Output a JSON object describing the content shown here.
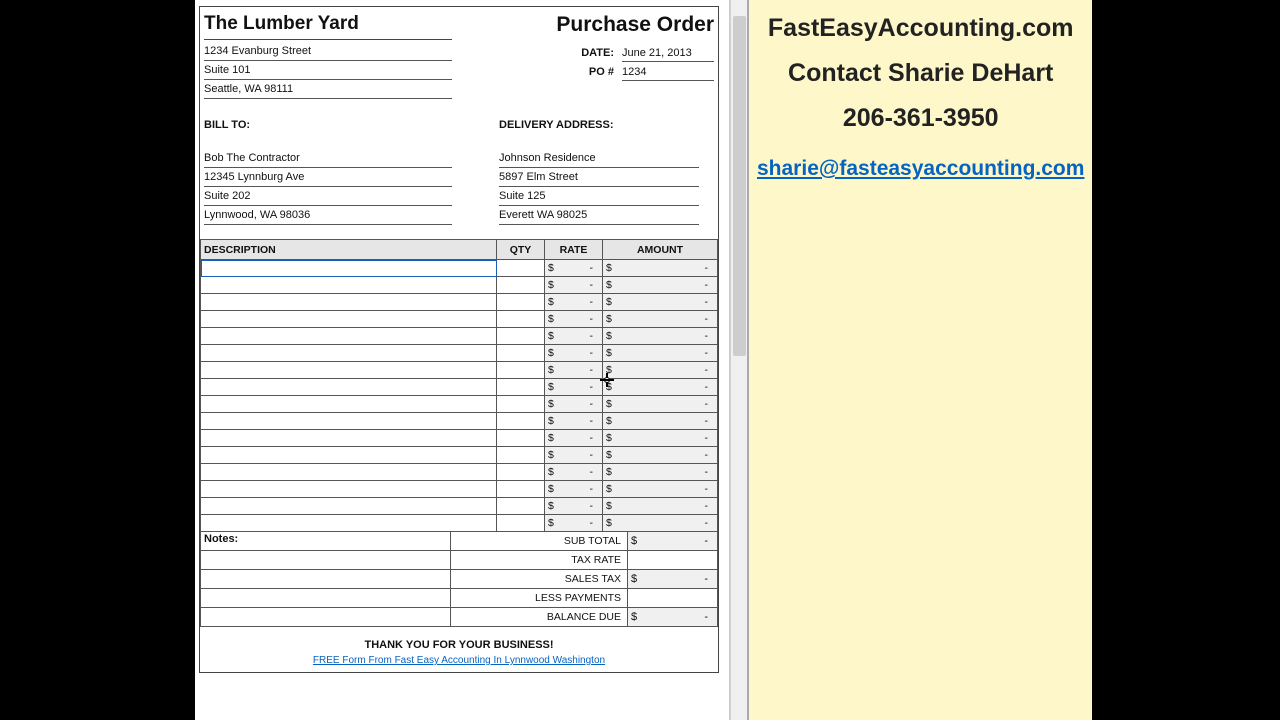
{
  "doc": {
    "title": "Purchase Order",
    "company": {
      "name": "The Lumber Yard",
      "addr1": "1234 Evanburg Street",
      "addr2": "Suite 101",
      "addr3": "Seattle, WA 98111"
    },
    "meta": {
      "date_label": "DATE:",
      "date_val": "June 21, 2013",
      "po_label": "PO #",
      "po_val": "1234"
    },
    "bill_to": {
      "head": "BILL TO:",
      "l1": "Bob The Contractor",
      "l2": "12345 Lynnburg Ave",
      "l3": "Suite 202",
      "l4": "Lynnwood, WA 98036"
    },
    "delivery": {
      "head": "DELIVERY ADDRESS:",
      "l1": "Johnson Residence",
      "l2": "5897 Elm Street",
      "l3": "Suite 125",
      "l4": "Everett WA 98025"
    },
    "headers": {
      "desc": "DESCRIPTION",
      "qty": "QTY",
      "rate": "RATE",
      "amount": "AMOUNT"
    },
    "notes_label": "Notes:",
    "totals": {
      "subtotal": "SUB TOTAL",
      "taxrate": "TAX RATE",
      "salestax": "SALES TAX",
      "lesspay": "LESS PAYMENTS",
      "balance": "BALANCE DUE"
    },
    "thanks": "THANK YOU FOR YOUR BUSINESS!",
    "freelink": "FREE Form From Fast Easy Accounting In Lynnwood Washington"
  },
  "info": {
    "l1": "FastEasyAccounting.com",
    "l2": "Contact Sharie DeHart",
    "l3": "206-361-3950",
    "email": "sharie@fasteasyaccounting.com"
  },
  "sym": {
    "dollar": "$",
    "dash": "-"
  }
}
